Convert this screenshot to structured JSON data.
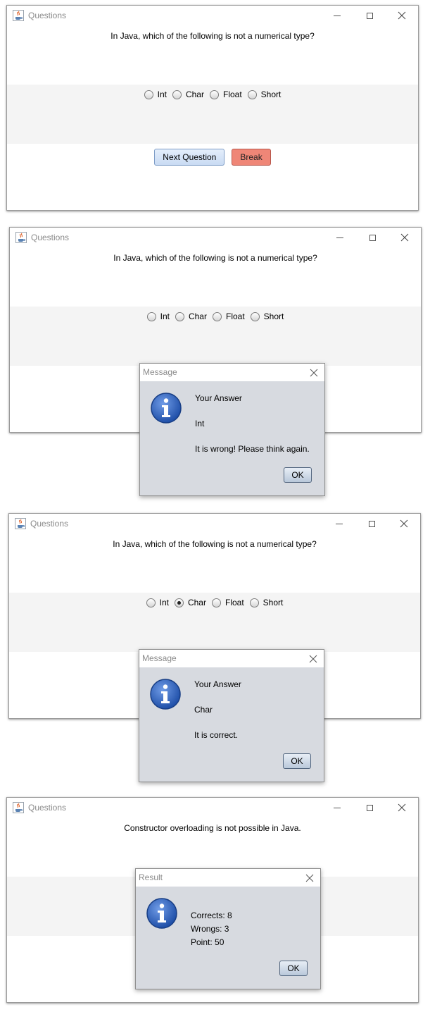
{
  "windows": [
    {
      "title": "Questions",
      "question": "In Java, which of the following is not a numerical type?",
      "options": [
        {
          "label": "Int",
          "checked": false
        },
        {
          "label": "Char",
          "checked": false
        },
        {
          "label": "Float",
          "checked": false
        },
        {
          "label": "Short",
          "checked": false
        }
      ],
      "buttons": {
        "next": "Next Question",
        "break": "Break"
      }
    },
    {
      "title": "Questions",
      "question": "In Java, which of the following is not a numerical type?",
      "options": [
        {
          "label": "Int",
          "checked": false
        },
        {
          "label": "Char",
          "checked": false
        },
        {
          "label": "Float",
          "checked": false
        },
        {
          "label": "Short",
          "checked": false
        }
      ],
      "dialog": {
        "title": "Message",
        "lines": [
          "Your Answer",
          "Int",
          "It is wrong! Please think again."
        ],
        "ok": "OK"
      }
    },
    {
      "title": "Questions",
      "question": "In Java, which of the following is not a numerical type?",
      "options": [
        {
          "label": "Int",
          "checked": false
        },
        {
          "label": "Char",
          "checked": true
        },
        {
          "label": "Float",
          "checked": false
        },
        {
          "label": "Short",
          "checked": false
        }
      ],
      "dialog": {
        "title": "Message",
        "lines": [
          "Your Answer",
          "Char",
          "It is correct."
        ],
        "ok": "OK"
      }
    },
    {
      "title": "Questions",
      "question": "Constructor overloading is not possible in Java.",
      "dialog": {
        "title": "Result",
        "lines": [
          "Corrects: 8",
          "Wrongs: 3",
          "Point: 50"
        ],
        "ok": "OK"
      }
    }
  ],
  "colors": {
    "next_button": "#c9dbf3",
    "break_button": "#ef8677",
    "dialog_body": "#d7dae0",
    "options_band": "#f4f4f4",
    "info_icon": "#2f5fb8"
  },
  "icons": {
    "app": "java-cup-icon",
    "dialog": "info-icon",
    "minimize": "minimize-icon",
    "maximize": "maximize-icon",
    "close": "close-icon"
  }
}
